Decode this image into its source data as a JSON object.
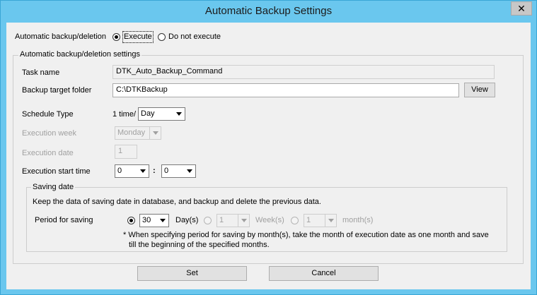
{
  "window": {
    "title": "Automatic Backup Settings",
    "close_glyph": "✕"
  },
  "backup_mode": {
    "label": "Automatic backup/deletion",
    "execute": "Execute",
    "not_execute": "Do not execute",
    "selected": "execute"
  },
  "settings_group": {
    "label": "Automatic backup/deletion settings",
    "task_name_label": "Task name",
    "task_name_value": "DTK_Auto_Backup_Command",
    "backup_folder_label": "Backup target folder",
    "backup_folder_value": "C:\\DTKBackup",
    "view_button": "View",
    "schedule_type_label": "Schedule Type",
    "schedule_prefix": "1 time/",
    "schedule_value": "Day",
    "execution_week_label": "Execution week",
    "execution_week_value": "Monday",
    "execution_date_label": "Execution date",
    "execution_date_value": "1",
    "start_time_label": "Execution start time",
    "start_hour_value": "0",
    "time_separator": ":",
    "start_minute_value": "0"
  },
  "saving_group": {
    "label": "Saving date",
    "description": "Keep the data of saving date in database, and backup and delete the previous data.",
    "period_label": "Period for saving",
    "days_value": "30",
    "days_unit": "Day(s)",
    "weeks_value": "1",
    "weeks_unit": "Week(s)",
    "months_value": "1",
    "months_unit": "month(s)",
    "note_line1": "* When specifying period for saving by month(s), take the month of execution date as one month and save",
    "note_line2": "till the beginning of the specified months."
  },
  "buttons": {
    "set": "Set",
    "cancel": "Cancel"
  }
}
